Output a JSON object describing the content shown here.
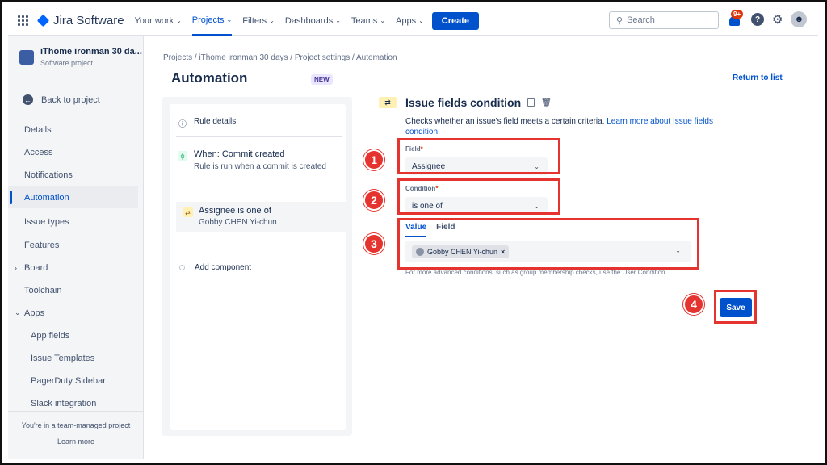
{
  "nav": {
    "app_name": "Jira Software",
    "items": [
      {
        "label": "Your work",
        "active": false
      },
      {
        "label": "Projects",
        "active": true
      },
      {
        "label": "Filters",
        "active": false
      },
      {
        "label": "Dashboards",
        "active": false
      },
      {
        "label": "Teams",
        "active": false
      },
      {
        "label": "Apps",
        "active": false
      }
    ],
    "create_label": "Create",
    "search_placeholder": "Search",
    "notifications_badge": "9+",
    "help_icon": "?",
    "icons": [
      "apps-grid-icon",
      "jira-logo-icon",
      "search-icon",
      "notification-icon",
      "help-icon",
      "settings-icon",
      "avatar"
    ]
  },
  "sidebar": {
    "project_name": "iThome ironman 30 da...",
    "project_type": "Software project",
    "back_label": "Back to project",
    "items": [
      {
        "label": "Details"
      },
      {
        "label": "Access"
      },
      {
        "label": "Notifications"
      },
      {
        "label": "Automation",
        "active": true
      },
      {
        "label": "Issue types"
      },
      {
        "label": "Features"
      },
      {
        "label": "Board",
        "expander": "›"
      },
      {
        "label": "Toolchain"
      },
      {
        "label": "Apps",
        "expander": "⌄"
      },
      {
        "label": "App fields",
        "sub": true
      },
      {
        "label": "Issue Templates",
        "sub": true
      },
      {
        "label": "PagerDuty Sidebar",
        "sub": true
      },
      {
        "label": "Slack integration",
        "sub": true
      }
    ],
    "footer_text": "You're in a team-managed project",
    "footer_link": "Learn more"
  },
  "breadcrumb": "Projects  /  iThome ironman 30 days  /  Project settings  /  Automation",
  "page_title": "Automation",
  "new_tag": "NEW",
  "return_link": "Return to list",
  "rule": {
    "details_label": "Rule details",
    "trigger_title": "When: Commit created",
    "trigger_desc": "Rule is run when a commit is created",
    "condition_title": "Assignee is one of",
    "condition_desc": "Gobby CHEN Yi-chun",
    "add_component": "Add component"
  },
  "config": {
    "title": "Issue fields condition",
    "desc_text": "Checks whether an issue's field meets a certain criteria. ",
    "desc_link": "Learn more about Issue fields condition",
    "field_label": "Field",
    "field_value": "Assignee",
    "condition_label": "Condition",
    "condition_value": "is one of",
    "tab_value": "Value",
    "tab_field": "Field",
    "chip_label": "Gobby CHEN Yi-chun",
    "chip_remove": "×",
    "help_text": "For more advanced conditions, such as group membership checks, use the User Condition",
    "save_label": "Save"
  },
  "annotations": {
    "color": "#e5342f",
    "numbers": [
      "1",
      "2",
      "3",
      "4"
    ]
  }
}
